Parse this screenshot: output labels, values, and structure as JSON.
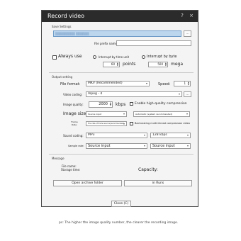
{
  "window": {
    "title": "Record video",
    "buttons": [
      "?",
      "×"
    ]
  },
  "save_settings": {
    "section": "Save Settings",
    "path_value": "▒▒▒▒▒▒▒▒▒ ▒▒▒▒▒▒",
    "browse_label": "...",
    "prefix_label": "File prefix name:",
    "always_use": "Always use",
    "interrupt_time": "Interrupt by time unit",
    "time_value": "60",
    "time_unit": "points",
    "interrupt_byte": "Interrupt by byte",
    "byte_value": "500",
    "byte_unit": "mega"
  },
  "output_setting": {
    "section": "Output setting",
    "format_label": "File format:",
    "format_value": "MKV (Recommended)",
    "speed_label": "Speed:",
    "speed_value": "1",
    "video_codec_label": "Video coding:",
    "video_codec_value": "mpeg - 4",
    "codec_browse": "...",
    "quality_label": "Image quality:",
    "quality_value": "2000",
    "quality_unit": "kbps",
    "hw_label": "Enable high-quality compression",
    "size_label": "Image size:",
    "size_value": "Source input",
    "size_option": "Automatic (system recommended)",
    "frame_label": "Frame Rate:",
    "frame_value": "The rate of frame source(recommended)",
    "multithread_label": "Backcasting multi-thread compression video",
    "sound_label": "Sound coding:",
    "sound_value": "MP3",
    "sound_bitrate": "128 kbps",
    "sample_label": "Sample rate:",
    "sample_value": "Source input",
    "channel_value": "Source input"
  },
  "message": {
    "section": "Message",
    "file_name_label": "File name:",
    "storage_label": "Storage time:",
    "capacity_label": "Capacity:",
    "open_button": "Open archive folder",
    "in_runs_button": "in Runs"
  },
  "close_button": "Close (C)",
  "caption": "ps: The higher the image quality number, the clearer the recording image."
}
